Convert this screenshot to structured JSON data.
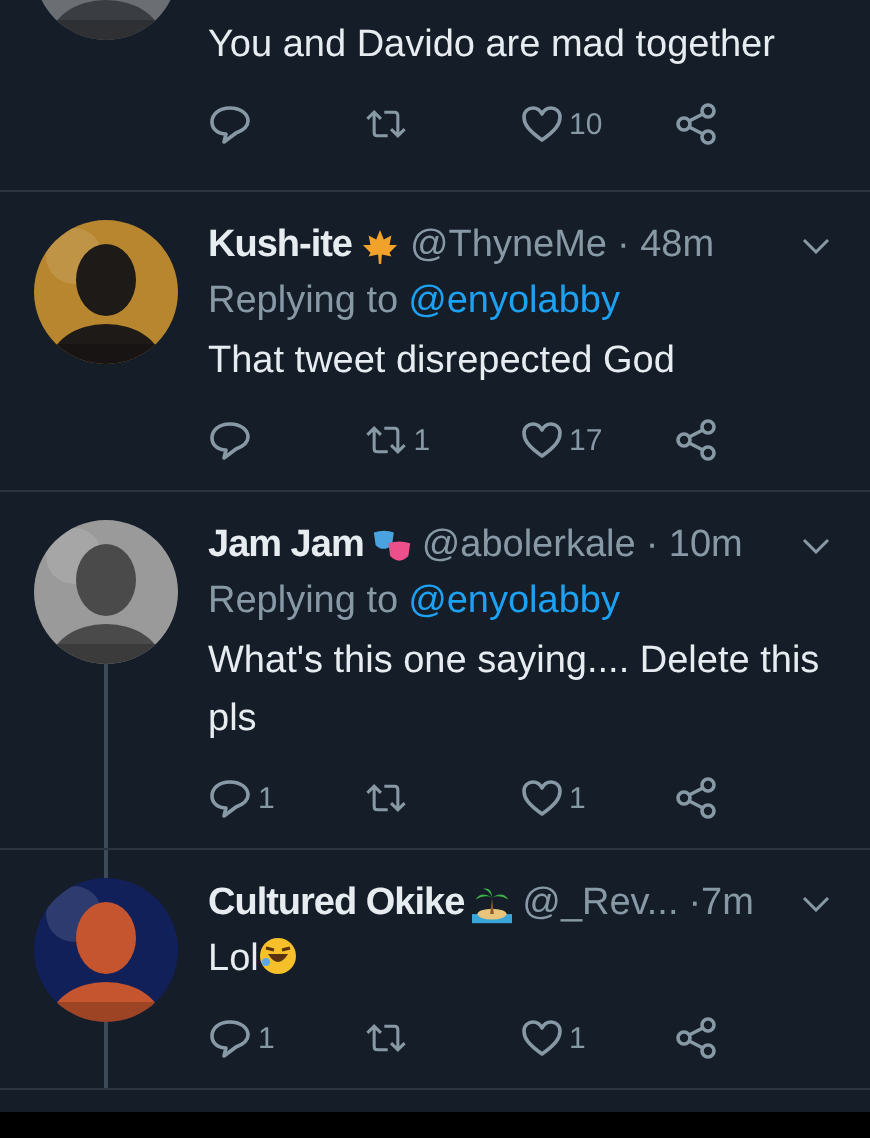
{
  "tweets": [
    {
      "cut_top": true,
      "text": "You and Davido are mad together",
      "actions": {
        "likes": "10"
      }
    },
    {
      "name": "Kush-ite",
      "badge": {
        "kind": "maple"
      },
      "handle": "@ThyneMe",
      "time": "· 48m",
      "reply_prefix": "Replying to",
      "reply_handle": "@enyolabby",
      "text": "That tweet disrepected God",
      "actions": {
        "retweets": "1",
        "likes": "17"
      }
    },
    {
      "thread_below": true,
      "name": "Jam Jam",
      "badge": {
        "kind": "masks"
      },
      "handle": "@abolerkale",
      "time": "· 10m",
      "reply_prefix": "Replying to",
      "reply_handle": "@enyolabby",
      "text": "What's this one saying.... Delete this pls",
      "actions": {
        "replies": "1",
        "likes": "1"
      }
    },
    {
      "thread_above": true,
      "thread_below": true,
      "name": "Cultured Okike",
      "badge": {
        "kind": "island"
      },
      "handle": "@_Rev...",
      "time": "·7m",
      "text": "Lol",
      "emoji": {
        "kind": "laugh"
      },
      "actions": {
        "replies": "1",
        "likes": "1"
      }
    }
  ]
}
